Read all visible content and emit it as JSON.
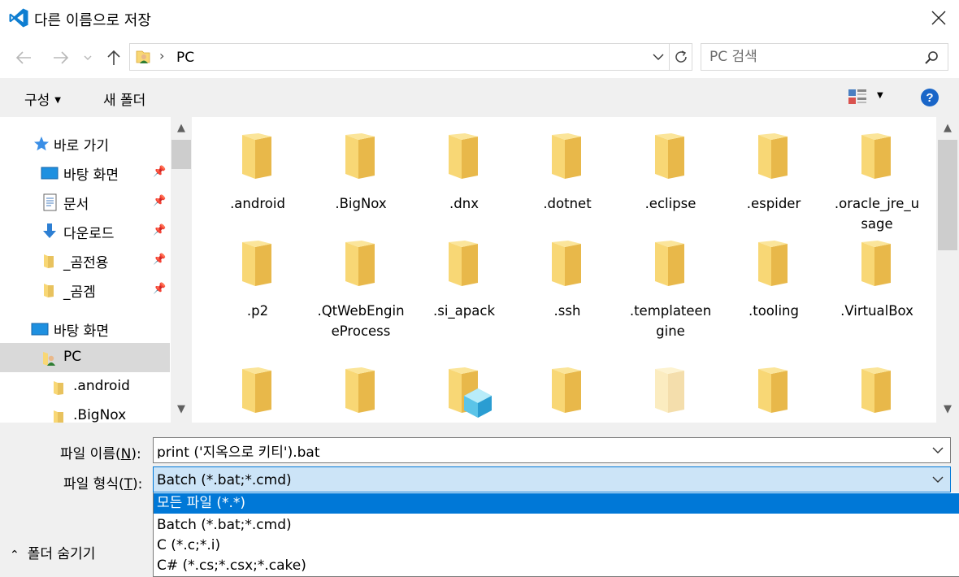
{
  "window": {
    "title": "다른 이름으로 저장",
    "close_icon": "close-icon",
    "app_icon": "vscode-icon"
  },
  "address_bar": {
    "path_separator": "›",
    "location": "PC",
    "search_placeholder": "PC 검색"
  },
  "command_bar": {
    "organize_label": "구성",
    "new_folder_label": "새 폴더",
    "help_label": "?"
  },
  "nav_pane": {
    "quick_access_label": "바로 가기",
    "items": [
      {
        "label": "바탕 화면",
        "icon": "desktop-icon",
        "pinned": true
      },
      {
        "label": "문서",
        "icon": "documents-icon",
        "pinned": true
      },
      {
        "label": "다운로드",
        "icon": "download-icon",
        "pinned": true
      },
      {
        "label": "_곰전용",
        "icon": "folder-icon",
        "pinned": true
      },
      {
        "label": "_곰겜",
        "icon": "folder-icon",
        "pinned": true
      }
    ],
    "desktop_label": "바탕 화면",
    "pc_label": "PC",
    "pc_children": [
      ".android",
      ".BigNox"
    ]
  },
  "files": [
    ".android",
    ".BigNox",
    ".dnx",
    ".dotnet",
    ".eclipse",
    ".espider",
    ".oracle_jre_usage",
    ".p2",
    ".QtWebEngineProcess",
    ".si_apack",
    ".ssh",
    ".templateengine",
    ".tooling",
    ".VirtualBox"
  ],
  "bottom": {
    "filename_label": "파일 이름(",
    "filename_accel": "N",
    "filename_label_end": "):",
    "filename_value": "print ('지옥으로 키티').bat",
    "filetype_label": "파일 형식(",
    "filetype_accel": "T",
    "filetype_label_end": "):",
    "filetype_value": "Batch (*.bat;*.cmd)",
    "filetype_options": [
      {
        "label": "모든 파일 (*.*)",
        "selected": true
      },
      {
        "label": "Batch (*.bat;*.cmd)",
        "selected": false
      },
      {
        "label": "C (*.c;*.i)",
        "selected": false
      },
      {
        "label": "C# (*.cs;*.csx;*.cake)",
        "selected": false
      }
    ],
    "hide_folders_label": "폴더 숨기기"
  },
  "colors": {
    "accent": "#0078d7",
    "folder_yellow": "#f8d775",
    "folder_shade": "#e8b84a"
  }
}
